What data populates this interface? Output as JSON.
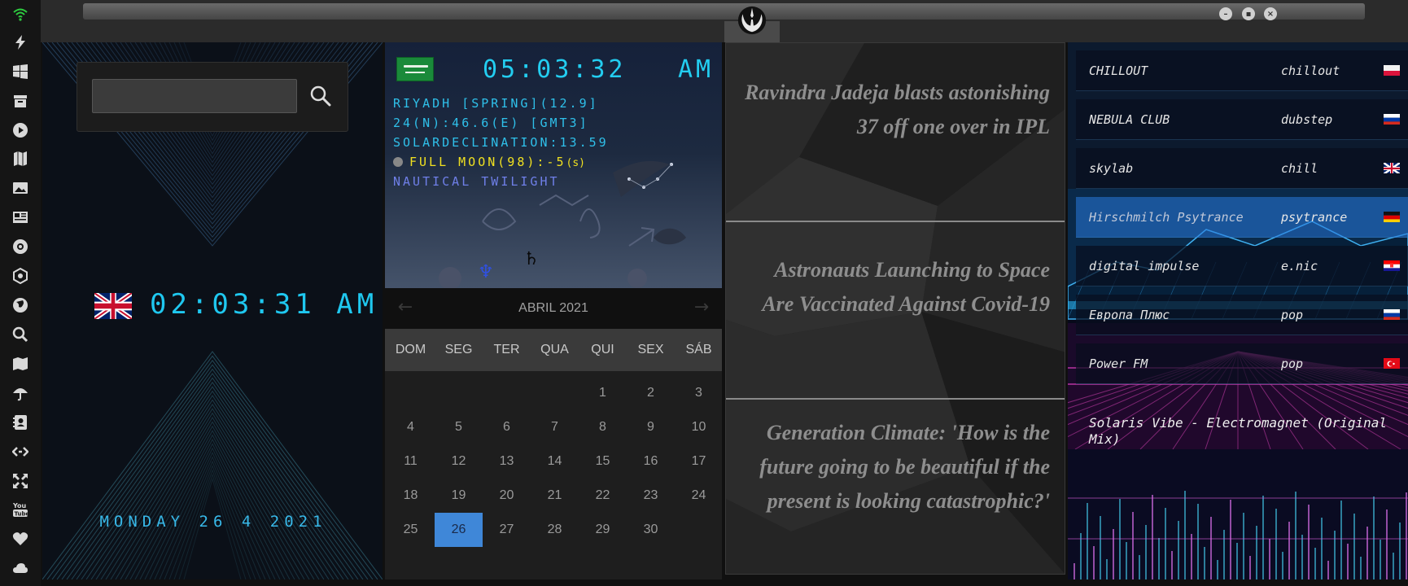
{
  "window": {
    "logo": "rebel-alliance-logo",
    "buttons": [
      "minimize",
      "maximize",
      "close"
    ]
  },
  "sidebar": {
    "icons": [
      "wifi-icon",
      "bolt-icon",
      "windows-icon",
      "archive-icon",
      "play-icon",
      "map-book-icon",
      "image-icon",
      "news-icon",
      "settings-wheel-icon",
      "hexagon-icon",
      "globe-icon",
      "search-icon",
      "map-icon",
      "umbrella-icon",
      "contact-icon",
      "code-icon",
      "expand-icon",
      "youtube-icon",
      "heart-icon",
      "cloud-icon"
    ]
  },
  "local_clock": {
    "search_placeholder": "",
    "flag": "uk-flag",
    "time": "02:03:31 AM",
    "date": "MONDAY 26 4 2021"
  },
  "world_clock": {
    "flag": "saudi-arabia-flag",
    "time": "05:03:32",
    "ampm": "AM",
    "location": "RIYADH [SPRING](12.9]",
    "coords": "24(N):46.6(E) [GMT3]",
    "declination": "SOLARDECLINATION:13.59",
    "moon": "FULL MOON(98):-5",
    "moon_suffix": "(s)",
    "twilight": "NAUTICAL TWILIGHT",
    "symbols": [
      "♄",
      "♆"
    ]
  },
  "calendar": {
    "title": "ABRIL 2021",
    "prev": "←",
    "next": "→",
    "weekdays": [
      "DOM",
      "SEG",
      "TER",
      "QUA",
      "QUI",
      "SEX",
      "SÁB"
    ],
    "first_weekday": 4,
    "days_in_month": 30,
    "selected": 26
  },
  "news": [
    "Ravindra Jadeja blasts astonishing 37 off one over in IPL",
    "Astronauts Launching to Space Are Vaccinated Against Covid-19",
    "Generation Climate: 'How is the future going to be beautiful if the present is looking catastrophic?'"
  ],
  "radio": {
    "stations": [
      {
        "name": "CHILLOUT",
        "genre": "chillout",
        "flag": "poland-flag"
      },
      {
        "name": "NEBULA CLUB",
        "genre": "dubstep",
        "flag": "russia-flag"
      },
      {
        "name": "skylab",
        "genre": "chill",
        "flag": "uk-flag"
      },
      {
        "name": "Hirschmilch Psytrance",
        "genre": "psytrance",
        "flag": "germany-flag"
      },
      {
        "name": "digital impulse",
        "genre": "e.nic",
        "flag": "croatia-flag"
      },
      {
        "name": "Европа Плюс",
        "genre": "pop",
        "flag": "russia-flag"
      },
      {
        "name": "Power FM",
        "genre": "pop",
        "flag": "turkey-flag"
      }
    ],
    "active_index": 3,
    "now_playing": "Solaris Vibe - Electromagnet (Original Mix)"
  }
}
